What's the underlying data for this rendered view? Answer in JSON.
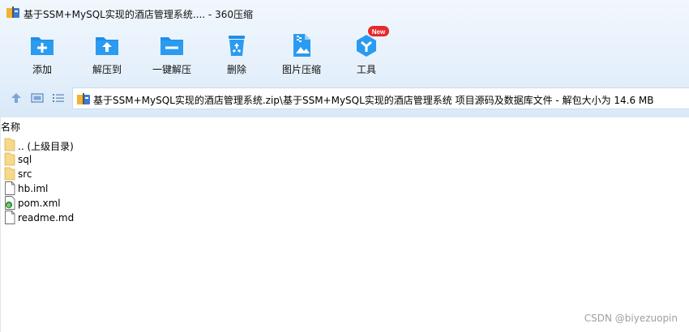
{
  "window": {
    "title": "基于SSM+MySQL实现的酒店管理系统.... - 360压缩",
    "logo_icon": "360zip-logo-icon"
  },
  "toolbar": {
    "add_label": "添加",
    "extract_to_label": "解压到",
    "one_click_extract_label": "一键解压",
    "delete_label": "删除",
    "image_compress_label": "图片压缩",
    "tools_label": "工具",
    "tools_badge": "New",
    "accent_color": "#1f8ee6"
  },
  "address": {
    "path": "基于SSM+MySQL实现的酒店管理系统.zip\\基于SSM+MySQL实现的酒店管理系统 项目源码及数据库文件 - 解包大小为 14.6 MB",
    "icon": "zip-archive-icon"
  },
  "list": {
    "column_name": "名称",
    "items": [
      {
        "name": ".. (上级目录)",
        "icon": "folder-icon"
      },
      {
        "name": "sql",
        "icon": "folder-icon"
      },
      {
        "name": "src",
        "icon": "folder-icon"
      },
      {
        "name": "hb.iml",
        "icon": "file-icon"
      },
      {
        "name": "pom.xml",
        "icon": "xml-file-icon"
      },
      {
        "name": "readme.md",
        "icon": "file-icon"
      }
    ]
  },
  "watermark": "CSDN @biyezuopin"
}
